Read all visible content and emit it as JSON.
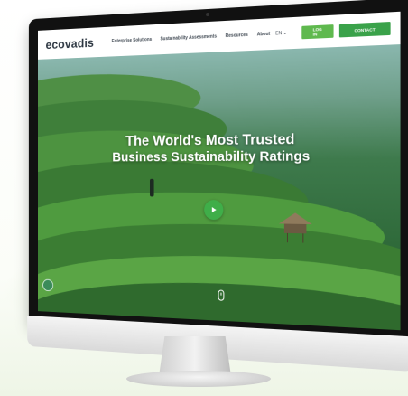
{
  "site": {
    "logo": "ecovadis",
    "nav": [
      "Enterprise Solutions",
      "Sustainability Assessments",
      "Resources",
      "About"
    ],
    "language": "EN ⌄",
    "login_label": "LOG IN",
    "contact_label": "CONTACT"
  },
  "hero": {
    "title_line1": "The World's Most Trusted",
    "title_line2": "Business Sustainability Ratings"
  },
  "colors": {
    "accent_green": "#3fae49",
    "login_green": "#5fb94e",
    "contact_green": "#3aa24a",
    "nav_text": "#3d4650"
  },
  "icons": [
    "search-icon",
    "play-icon",
    "scroll-mouse-icon",
    "chat-badge-icon"
  ]
}
